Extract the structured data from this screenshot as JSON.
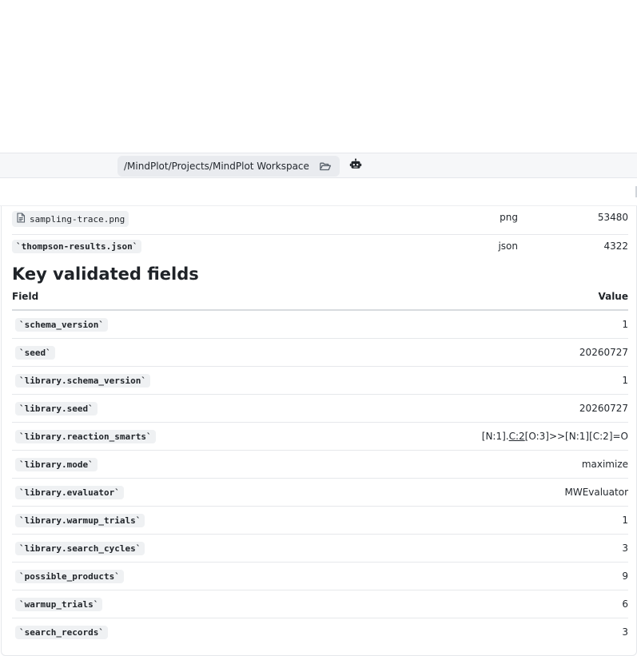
{
  "toolbar": {
    "path": "/MindPlot/Projects/MindPlot Workspace",
    "folder_icon": "folder-open-icon",
    "assistant_icon": "robot-icon"
  },
  "files": [
    {
      "name": "sampling-trace.png",
      "type": "png",
      "size": "53480",
      "icon": "file-icon"
    },
    {
      "name": "`thompson-results.json`",
      "type": "json",
      "size": "4322"
    }
  ],
  "section": {
    "title": "Key validated fields"
  },
  "fields_table": {
    "headers": {
      "field": "Field",
      "value": "Value"
    },
    "rows": [
      {
        "field": "`schema_version`",
        "value": "1"
      },
      {
        "field": "`seed`",
        "value": "20260727"
      },
      {
        "field": "`library.schema_version`",
        "value": "1"
      },
      {
        "field": "`library.seed`",
        "value": "20260727"
      },
      {
        "field": "`library.reaction_smarts`",
        "value_pre": "[N:1].",
        "value_mid": "C:2",
        "value_post": "[O:3]>>[N:1][C:2]=O"
      },
      {
        "field": "`library.mode`",
        "value": "maximize"
      },
      {
        "field": "`library.evaluator`",
        "value": "MWEvaluator"
      },
      {
        "field": "`library.warmup_trials`",
        "value": "1"
      },
      {
        "field": "`library.search_cycles`",
        "value": "3"
      },
      {
        "field": "`possible_products`",
        "value": "9"
      },
      {
        "field": "`warmup_trials`",
        "value": "6"
      },
      {
        "field": "`search_records`",
        "value": "3"
      }
    ]
  }
}
